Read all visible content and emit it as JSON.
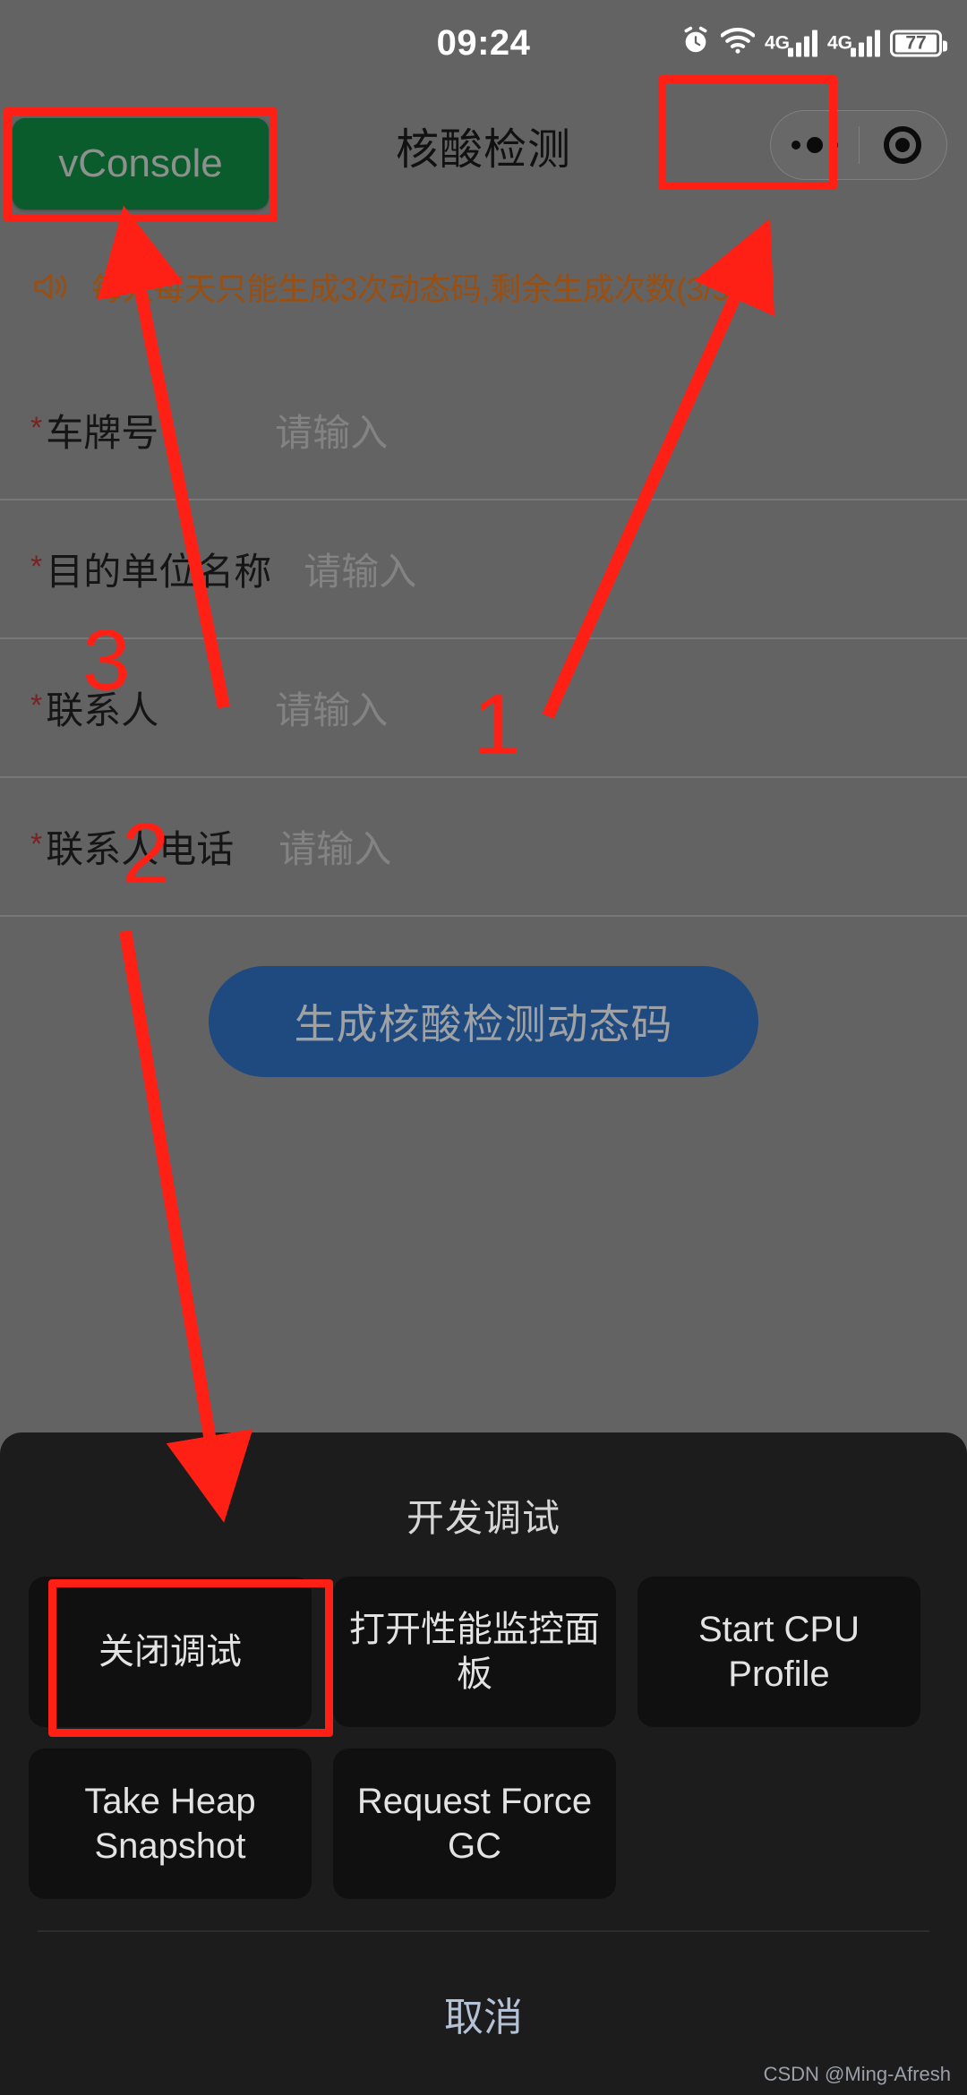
{
  "status_bar": {
    "time": "09:24",
    "icons": [
      "alarm-icon",
      "wifi-icon",
      "signal-4g-icon",
      "signal-4g-icon-2",
      "battery-icon"
    ],
    "network_label_1": "4G",
    "network_label_2": "4G",
    "battery_percent": "77"
  },
  "nav": {
    "title": "核酸检测",
    "capsule_more": "more-dots-icon",
    "capsule_target": "target-circle-icon"
  },
  "vconsole": {
    "label": "vConsole"
  },
  "notice": {
    "icon": "speaker-icon",
    "text": "每人每天只能生成3次动态码,剩余生成次数(3/3)"
  },
  "form": {
    "required_mark": "*",
    "fields": [
      {
        "label": "车牌号",
        "value": "",
        "placeholder": "请输入"
      },
      {
        "label": "目的单位名称",
        "value": "",
        "placeholder": "请输入"
      },
      {
        "label": "联系人",
        "value": "",
        "placeholder": "请输入"
      },
      {
        "label": "联系人电话",
        "value": "",
        "placeholder": "请输入"
      }
    ],
    "submit_label": "生成核酸检测动态码"
  },
  "action_sheet": {
    "title": "开发调试",
    "buttons": [
      "关闭调试",
      "打开性能监控面板",
      "Start CPU Profile",
      "Take Heap Snapshot",
      "Request Force GC"
    ],
    "cancel_label": "取消"
  },
  "watermark": "CSDN @Ming-Afresh",
  "annotations": {
    "numbers": [
      "1",
      "2",
      "3"
    ],
    "accent_color": "#ff2015"
  }
}
